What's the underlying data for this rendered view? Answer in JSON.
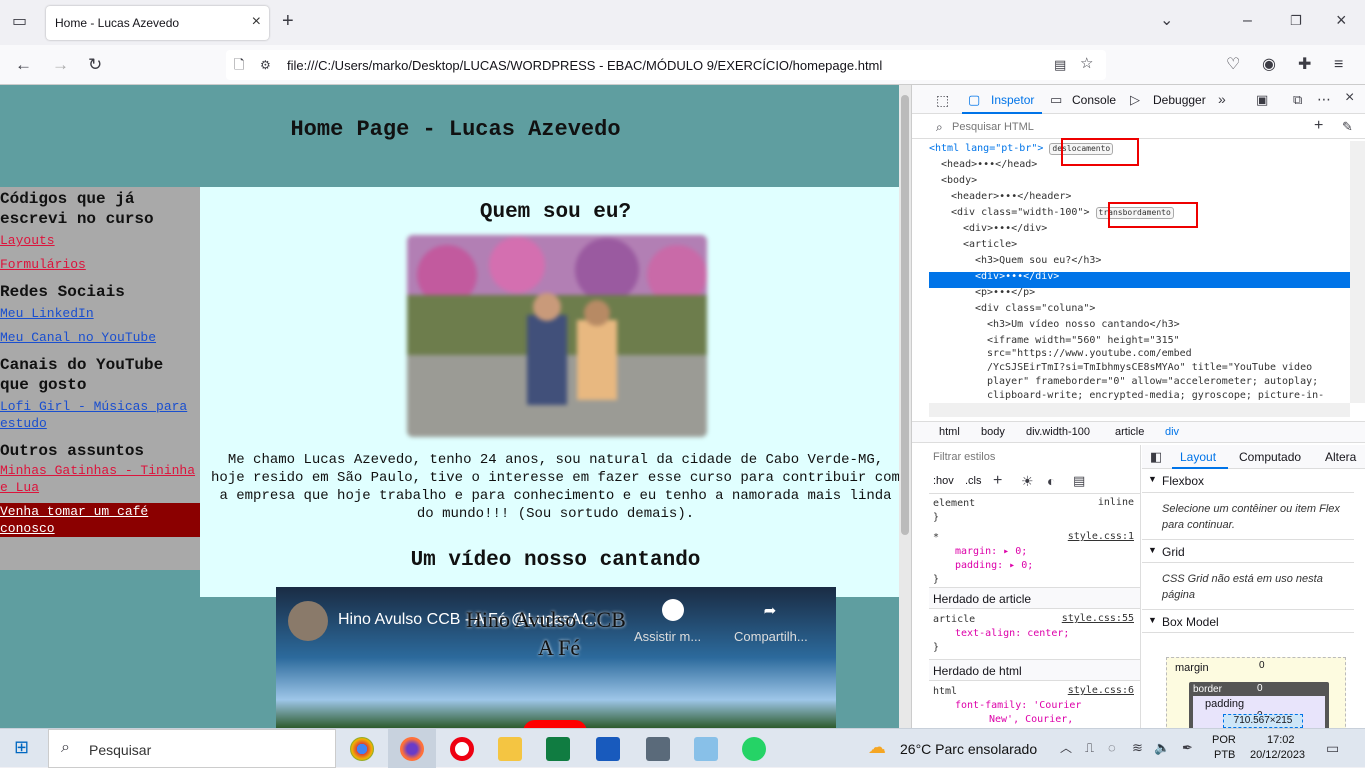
{
  "browser": {
    "tab_title": "Home - Lucas Azevedo",
    "url": "file:///C:/Users/marko/Desktop/LUCAS/WORDPRESS - EBAC/MÓDULO 9/EXERCÍCIO/homepage.html"
  },
  "page": {
    "title": "Home Page - Lucas Azevedo",
    "sidebar": {
      "sections": [
        {
          "heading": "Códigos que já escrevi no curso",
          "links": [
            "Layouts",
            "Formulários"
          ]
        },
        {
          "heading": "Redes Sociais",
          "links": [
            "Meu LinkedIn",
            "Meu Canal no YouTube"
          ]
        },
        {
          "heading": "Canais do YouTube que gosto",
          "links": [
            "Lofi Girl - Músicas para estudo"
          ]
        },
        {
          "heading": "Outros assuntos",
          "links": [
            "Minhas Gatinhas - Tininha e Lua",
            "Venha tomar um café conosco"
          ]
        }
      ]
    },
    "about_heading": "Quem sou eu?",
    "about_text": "Me chamo Lucas Azevedo, tenho 24 anos, sou natural da cidade de Cabo Verde-MG, hoje resido em São Paulo, tive o interesse em fazer esse curso para contribuir com a empresa que hoje trabalho e para conhecimento e eu tenho a namorada mais linda do mundo!!! (Sou sortudo demais).",
    "video_heading": "Um vídeo nosso cantando",
    "video": {
      "title": "Hino Avulso CCB - A Fé @LucasAz...",
      "overlay": "Hino Avulso CCB",
      "overlay2": "A Fé",
      "watch_later": "Assistir m...",
      "share": "Compartilh..."
    }
  },
  "devtools": {
    "tabs": [
      "Inspetor",
      "Console",
      "Debugger"
    ],
    "search_placeholder": "Pesquisar HTML",
    "badge_shift": "deslocamento",
    "badge_overflow": "transbordamento",
    "markup": [
      "<html lang=\"pt-br\">",
      "<head>•••</head>",
      "<body>",
      "<header>•••</header>",
      "<div class=\"width-100\">",
      "<div>•••</div>",
      "<article>",
      "<h3>Quem sou eu?</h3>",
      "<div>•••</div>",
      "<p>•••</p>",
      "<div class=\"coluna\">",
      "<h3>Um vídeo nosso cantando</h3>",
      "<iframe width=\"560\" height=\"315\"",
      "src=\"https://www.youtube.com/embed",
      "/YcSJSEirTmI?si=TmIbhmysCE8sMYAo\" title=\"YouTube video",
      "player\" frameborder=\"0\" allow=\"accelerometer; autoplay;",
      "clipboard-write; encrypted-media; gyroscope; picture-in-"
    ],
    "breadcrumbs": [
      "html",
      "body",
      "div.width-100",
      "article",
      "div"
    ],
    "filter_placeholder": "Filtrar estilos",
    "hov": ":hov",
    "cls": ".cls",
    "rules": {
      "element": "element",
      "inline": "inline",
      "star_selector": "*",
      "margin": "margin: ▸ 0;",
      "padding": "padding: ▸ 0;",
      "src1": "style.css:1",
      "inherited_article": "Herdado de article",
      "article_selector": "article",
      "text_align": "text-align: center;",
      "src55": "style.css:55",
      "inherited_html": "Herdado de html",
      "html_selector": "html",
      "font_family": "font-family: 'Courier",
      "font_family2": "New', Courier,",
      "src6": "style.css:6"
    },
    "layout_tabs": [
      "Layout",
      "Computado",
      "Altera"
    ],
    "flexbox": "Flexbox",
    "flexbox_note": "Selecione um contêiner ou item Flex para continuar.",
    "grid": "Grid",
    "grid_note": "CSS Grid não está em uso nesta página",
    "boxmodel": "Box Model",
    "margin_label": "margin",
    "border_label": "border",
    "padding_label": "padding",
    "size": "710.567×215",
    "zero": "0"
  },
  "taskbar": {
    "search": "Pesquisar",
    "weather": "26°C  Parc ensolarado",
    "lang1": "POR",
    "lang2": "PTB",
    "time": "17:02",
    "date": "20/12/2023"
  }
}
